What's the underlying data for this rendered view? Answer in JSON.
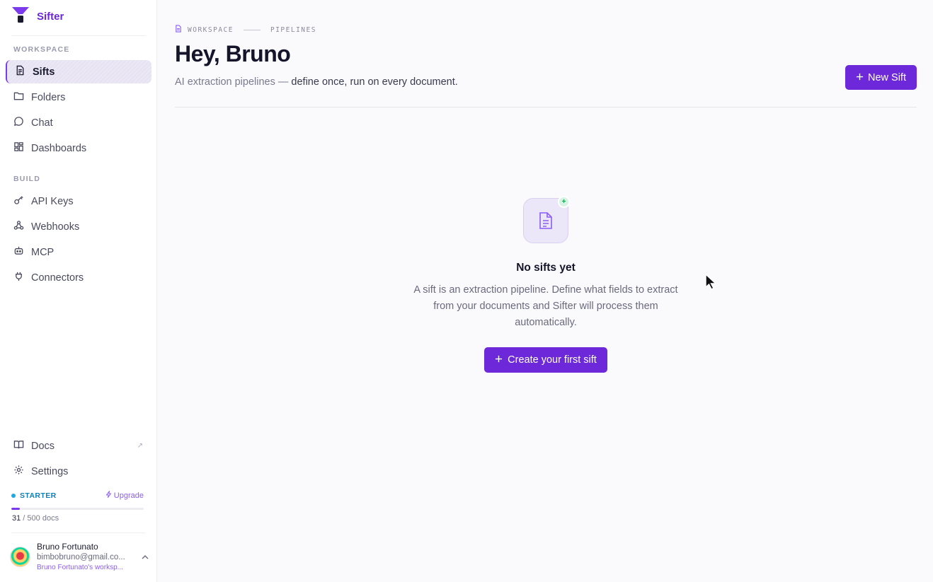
{
  "brand": {
    "name": "Sifter",
    "color": "#6d28d9"
  },
  "sidebar": {
    "workspace_label": "WORKSPACE",
    "workspace_items": [
      {
        "label": "Sifts",
        "icon": "file-text-icon",
        "active": true
      },
      {
        "label": "Folders",
        "icon": "folder-icon"
      },
      {
        "label": "Chat",
        "icon": "chat-bubble-icon"
      },
      {
        "label": "Dashboards",
        "icon": "dashboard-grid-icon"
      }
    ],
    "build_label": "BUILD",
    "build_items": [
      {
        "label": "API Keys",
        "icon": "key-icon"
      },
      {
        "label": "Webhooks",
        "icon": "webhook-icon"
      },
      {
        "label": "MCP",
        "icon": "robot-icon"
      },
      {
        "label": "Connectors",
        "icon": "plug-icon"
      }
    ],
    "bottom_items": [
      {
        "label": "Docs",
        "icon": "book-icon",
        "external": "↗"
      },
      {
        "label": "Settings",
        "icon": "gear-icon"
      }
    ],
    "plan": {
      "name": "STARTER",
      "upgrade_label": "Upgrade",
      "used": "31",
      "limit_text": " / 500 docs",
      "usage_fraction": 0.062
    },
    "user": {
      "name": "Bruno Fortunato",
      "email": "bimbobruno@gmail.co...",
      "workspace": "Bruno Fortunato's worksp..."
    }
  },
  "main": {
    "breadcrumb": [
      "WORKSPACE",
      "PIPELINES"
    ],
    "title": "Hey, Bruno",
    "subtitle_muted": "AI extraction pipelines — ",
    "subtitle_strong": "define once, run on every document.",
    "new_button_label": "New Sift",
    "empty_state": {
      "title": "No sifts yet",
      "description": "A sift is an extraction pipeline. Define what fields to extract from your documents and Sifter will process them automatically.",
      "button_label": "Create your first sift"
    }
  },
  "colors": {
    "accent": "#6d28d9",
    "plan_blue": "#0e7fb8",
    "badge_green": "#16a34a"
  }
}
